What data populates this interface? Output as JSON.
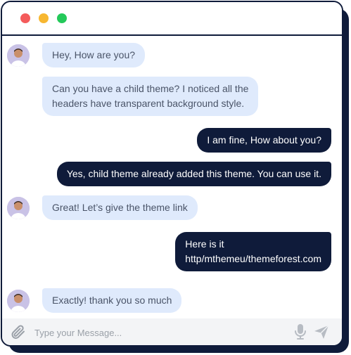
{
  "window": {
    "controls": [
      "close",
      "minimize",
      "maximize"
    ]
  },
  "messages": [
    {
      "side": "in",
      "text": "Hey, How are you?"
    },
    {
      "side": "in",
      "text": "Can you have a child theme? I noticed all the\nheaders have transparent background style."
    },
    {
      "side": "out",
      "text": "I am fine, How about you?"
    },
    {
      "side": "out",
      "text": "Yes, child theme already added this theme. You can use it."
    },
    {
      "side": "in",
      "text": "Great! Let’s give the theme link"
    },
    {
      "side": "out",
      "text": "Here is it\nhttp/mthemeu/themeforest.com"
    },
    {
      "side": "in",
      "text": "Exactly! thank you so much"
    }
  ],
  "composer": {
    "placeholder": "Type your Message...",
    "value": "",
    "icons": [
      "paperclip-icon",
      "microphone-icon",
      "send-icon"
    ]
  },
  "colors": {
    "dark": "#0f1b3a",
    "incoming_bubble": "#dfeafc",
    "incoming_text": "#4a5468",
    "close": "#f45b5b",
    "minimize": "#f7b731",
    "maximize": "#24c95a"
  }
}
